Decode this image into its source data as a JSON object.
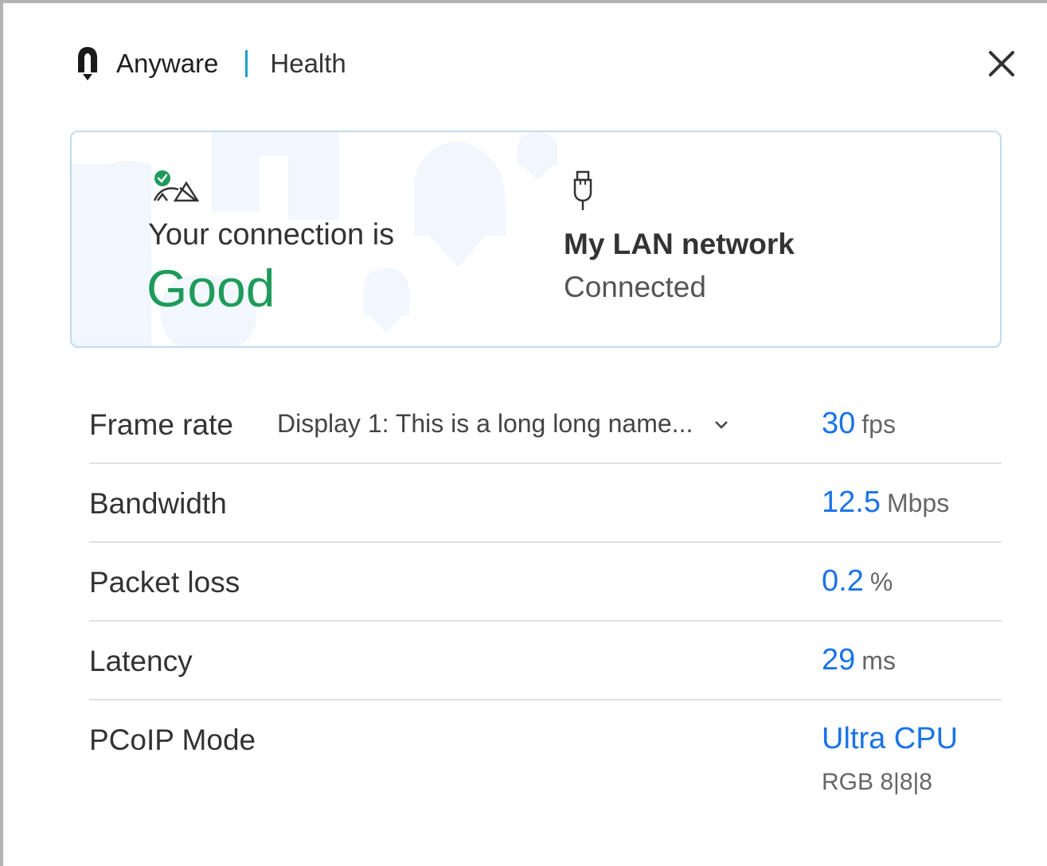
{
  "header": {
    "brand": "Anyware",
    "section": "Health",
    "logo_icon": "anyware-logo-icon",
    "close_icon": "close-icon"
  },
  "connection": {
    "icon": "connection-quality-icon",
    "label": "Your connection is",
    "status": "Good",
    "status_color": "#1e9b5a"
  },
  "network": {
    "icon": "ethernet-plug-icon",
    "name": "My LAN network",
    "status": "Connected"
  },
  "metrics": {
    "frame_rate": {
      "label": "Frame rate",
      "display_selected": "Display 1: This is a long long name...",
      "value": "30",
      "unit": "fps"
    },
    "bandwidth": {
      "label": "Bandwidth",
      "value": "12.5",
      "unit": "Mbps"
    },
    "packet_loss": {
      "label": "Packet loss",
      "value": "0.2",
      "unit": "%"
    },
    "latency": {
      "label": "Latency",
      "value": "29",
      "unit": "ms"
    },
    "pcoip_mode": {
      "label": "PCoIP Mode",
      "value": "Ultra CPU",
      "sub": "RGB 8|8|8"
    }
  },
  "colors": {
    "accent": "#1a73e8",
    "good": "#1e9b5a",
    "divider": "#1aa0c8",
    "card_border": "#bfdcf3"
  }
}
